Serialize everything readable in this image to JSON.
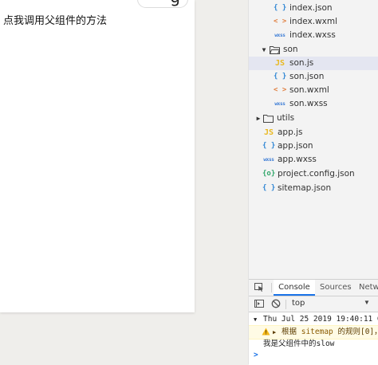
{
  "simulator": {
    "capsule_glyph": "g",
    "page_text": "点我调用父组件的方法"
  },
  "file_tree": {
    "items": [
      {
        "icon": "json-file-icon",
        "icon_text": "{ }",
        "label": "index.json"
      },
      {
        "icon": "wxml-file-icon",
        "icon_text": "< >",
        "label": "index.wxml"
      },
      {
        "icon": "wxss-file-icon",
        "icon_text": "wxss",
        "label": "index.wxss"
      },
      {
        "icon": "folder-open-icon",
        "label": "son"
      },
      {
        "icon": "js-file-icon",
        "icon_text": "JS",
        "label": "son.js",
        "selected": true
      },
      {
        "icon": "json-file-icon",
        "icon_text": "{ }",
        "label": "son.json"
      },
      {
        "icon": "wxml-file-icon",
        "icon_text": "< >",
        "label": "son.wxml"
      },
      {
        "icon": "wxss-file-icon",
        "icon_text": "wxss",
        "label": "son.wxss"
      },
      {
        "icon": "folder-closed-icon",
        "label": "utils"
      },
      {
        "icon": "js-file-icon",
        "icon_text": "JS",
        "label": "app.js"
      },
      {
        "icon": "json-file-icon",
        "icon_text": "{ }",
        "label": "app.json"
      },
      {
        "icon": "wxss-file-icon",
        "icon_text": "wxss",
        "label": "app.wxss"
      },
      {
        "icon": "config-file-icon",
        "icon_text": "{o}",
        "label": "project.config.json"
      },
      {
        "icon": "json-file-icon",
        "icon_text": "{ }",
        "label": "sitemap.json"
      }
    ]
  },
  "devtools": {
    "tabs": [
      {
        "label": "Console",
        "active": true
      },
      {
        "label": "Sources",
        "active": false
      },
      {
        "label": "Netw",
        "active": false
      }
    ],
    "context_selector": "top",
    "console": {
      "log_header": "Thu Jul 25 2019 19:40:11 GMT+",
      "warning_prefix": "根据 ",
      "warning_code": "sitemap",
      "warning_suffix": " 的规则[0]，当",
      "log_message": "我是父组件中的slow",
      "prompt_symbol": ">"
    }
  },
  "colors": {
    "accent": "#1a73e8",
    "warning_bg": "#fffbe5",
    "selected_row": "#e4e6f1"
  }
}
